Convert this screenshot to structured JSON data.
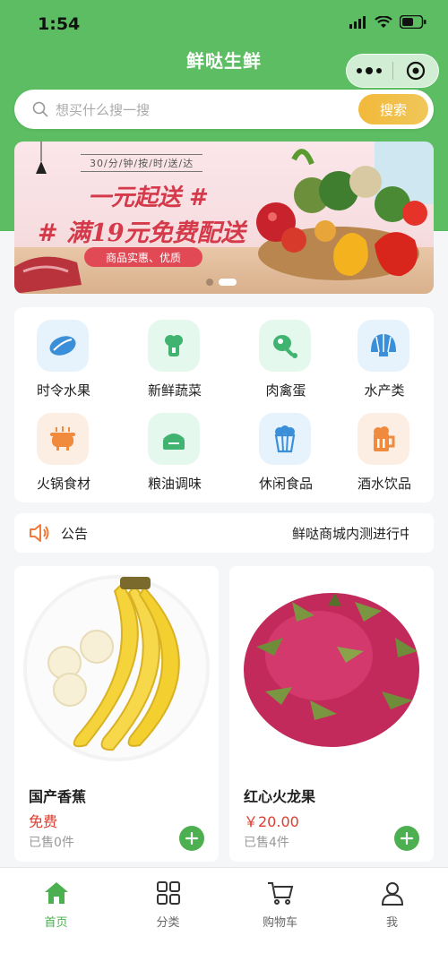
{
  "status_bar": {
    "time": "1:54"
  },
  "header": {
    "title": "鲜哒生鲜"
  },
  "search": {
    "placeholder": "想买什么搜一搜",
    "button_label": "搜索"
  },
  "banner": {
    "tagline": "30/分/钟/按/时/送/达",
    "line1": "一元起送 #",
    "line2": "# 满19元免费配送",
    "pill": "商品实惠、优质"
  },
  "categories": [
    {
      "label": "时令水果",
      "icon": "mango-icon",
      "bg": "#e6f3fd"
    },
    {
      "label": "新鲜蔬菜",
      "icon": "vegetable-icon",
      "bg": "#e4f8ee"
    },
    {
      "label": "肉禽蛋",
      "icon": "drumstick-icon",
      "bg": "#e4f8ee"
    },
    {
      "label": "水产类",
      "icon": "shell-icon",
      "bg": "#e6f3fd"
    },
    {
      "label": "火锅食材",
      "icon": "hotpot-icon",
      "bg": "#fdeee4"
    },
    {
      "label": "粮油调味",
      "icon": "rice-icon",
      "bg": "#e4f8ee"
    },
    {
      "label": "休闲食品",
      "icon": "popcorn-icon",
      "bg": "#e6f3fd"
    },
    {
      "label": "酒水饮品",
      "icon": "beer-icon",
      "bg": "#fdeee4"
    }
  ],
  "notice": {
    "label": "公告",
    "text": "鲜哒商城内测进行中"
  },
  "products": [
    {
      "name": "国产香蕉",
      "price": "免费",
      "sold": "已售0件"
    },
    {
      "name": "红心火龙果",
      "price": "￥20.00",
      "sold": "已售4件"
    }
  ],
  "tabbar": {
    "items": [
      {
        "label": "首页",
        "icon": "home-icon"
      },
      {
        "label": "分类",
        "icon": "grid-icon"
      },
      {
        "label": "购物车",
        "icon": "cart-icon"
      },
      {
        "label": "我",
        "icon": "user-icon"
      }
    ],
    "active_color": "#4caf50"
  },
  "colors": {
    "brand_green": "#5cbd62",
    "search_button": "#f2b93a",
    "price_red": "#e03b2e"
  }
}
